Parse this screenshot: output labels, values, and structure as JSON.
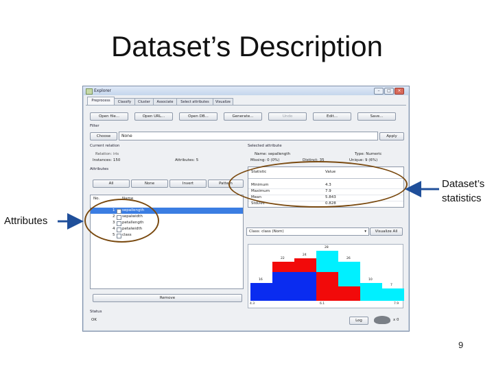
{
  "slide": {
    "title": "Dataset’s Description",
    "page_number": "9",
    "annotations": {
      "right": "Dataset’s\nstatistics",
      "left": "Attributes"
    }
  },
  "window": {
    "title": "Explorer",
    "tabs": [
      "Preprocess",
      "Classify",
      "Cluster",
      "Associate",
      "Select attributes",
      "Visualize"
    ],
    "toolbar": [
      "Open file...",
      "Open URL...",
      "Open DB...",
      "Generate...",
      "Undo",
      "Edit...",
      "Save..."
    ],
    "filter": {
      "label": "Filter",
      "choose": "Choose",
      "value": "None",
      "apply": "Apply"
    },
    "current_relation": {
      "title": "Current relation",
      "relation": "Relation: iris",
      "instances": "Instances: 150",
      "attributes": "Attributes: 5"
    },
    "attributes_panel": {
      "title": "Attributes",
      "buttons": [
        "All",
        "None",
        "Invert",
        "Pattern"
      ],
      "col_no": "No.",
      "col_name": "Name",
      "rows": [
        {
          "no": "1",
          "name": "sepallength"
        },
        {
          "no": "2",
          "name": "sepalwidth"
        },
        {
          "no": "3",
          "name": "petallength"
        },
        {
          "no": "4",
          "name": "petalwidth"
        },
        {
          "no": "5",
          "name": "class"
        }
      ],
      "remove": "Remove"
    },
    "selected_attribute": {
      "title": "Selected attribute",
      "name": "Name: sepallength",
      "type": "Type: Numeric",
      "missing": "Missing: 0 (0%)",
      "distinct": "Distinct: 35",
      "unique": "Unique: 9 (6%)",
      "col_stat": "Statistic",
      "col_value": "Value",
      "stats": [
        {
          "stat": "Minimum",
          "value": "4.3"
        },
        {
          "stat": "Maximum",
          "value": "7.9"
        },
        {
          "stat": "Mean",
          "value": "5.843"
        },
        {
          "stat": "StdDev",
          "value": "0.828"
        }
      ]
    },
    "class_select": "Class: class (Nom)",
    "visualize_all": "Visualize All",
    "histogram": {
      "bins": [
        {
          "label": "16",
          "blue": 10,
          "red": 0,
          "cyan": 0
        },
        {
          "label": "22",
          "blue": 16,
          "red": 6,
          "cyan": 0
        },
        {
          "label": "24",
          "blue": 16,
          "red": 8,
          "cyan": 0
        },
        {
          "label": "28",
          "blue": 0,
          "red": 16,
          "cyan": 12
        },
        {
          "label": "26",
          "blue": 0,
          "red": 8,
          "cyan": 14
        },
        {
          "label": "10",
          "blue": 0,
          "red": 0,
          "cyan": 10
        },
        {
          "label": "7",
          "blue": 0,
          "red": 0,
          "cyan": 7
        }
      ],
      "x_min": "4.3",
      "x_mid": "6.1",
      "x_max": "7.9",
      "colors": {
        "blue": "#0a2cf0",
        "red": "#f20a0a",
        "cyan": "#00f0ff"
      }
    },
    "status": {
      "title": "Status",
      "text": "OK",
      "log": "Log",
      "count": "x 0"
    }
  }
}
